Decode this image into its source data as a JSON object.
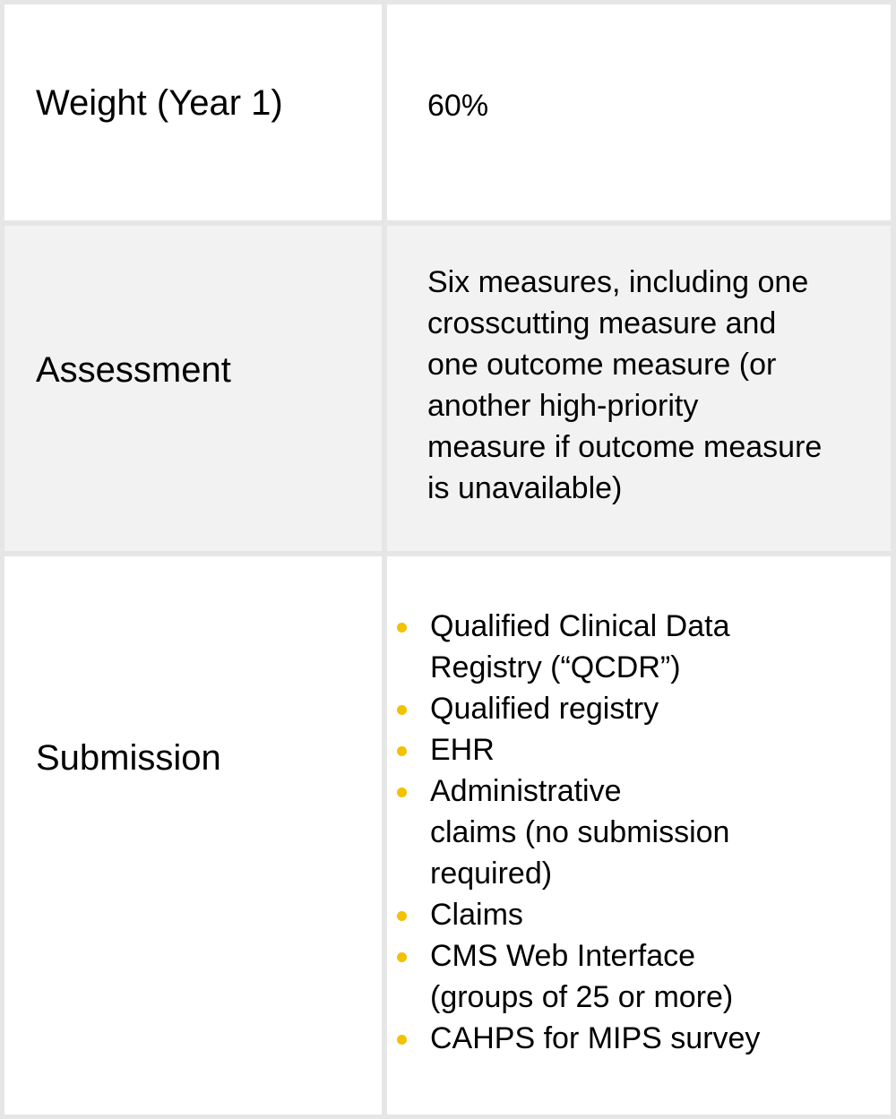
{
  "accent_color": "#f2c100",
  "rows": [
    {
      "label": "Weight (Year 1)",
      "value": "60%"
    },
    {
      "label": "Assessment",
      "value_lines": [
        "Six measures, including one",
        "crosscutting measure and",
        "one outcome measure (or",
        "another high-priority",
        "measure if outcome measure",
        "is unavailable)"
      ]
    },
    {
      "label": "Submission",
      "items": [
        {
          "lines": [
            "Qualified Clinical Data",
            "Registry (“QCDR”)"
          ]
        },
        {
          "lines": [
            "Qualified registry"
          ]
        },
        {
          "lines": [
            "EHR"
          ]
        },
        {
          "lines": [
            "Administrative",
            "claims (no submission",
            "required)"
          ]
        },
        {
          "lines": [
            "Claims"
          ]
        },
        {
          "lines": [
            "CMS Web Interface",
            "(groups of 25 or more)"
          ]
        },
        {
          "lines": [
            "CAHPS for MIPS survey"
          ]
        }
      ]
    }
  ]
}
